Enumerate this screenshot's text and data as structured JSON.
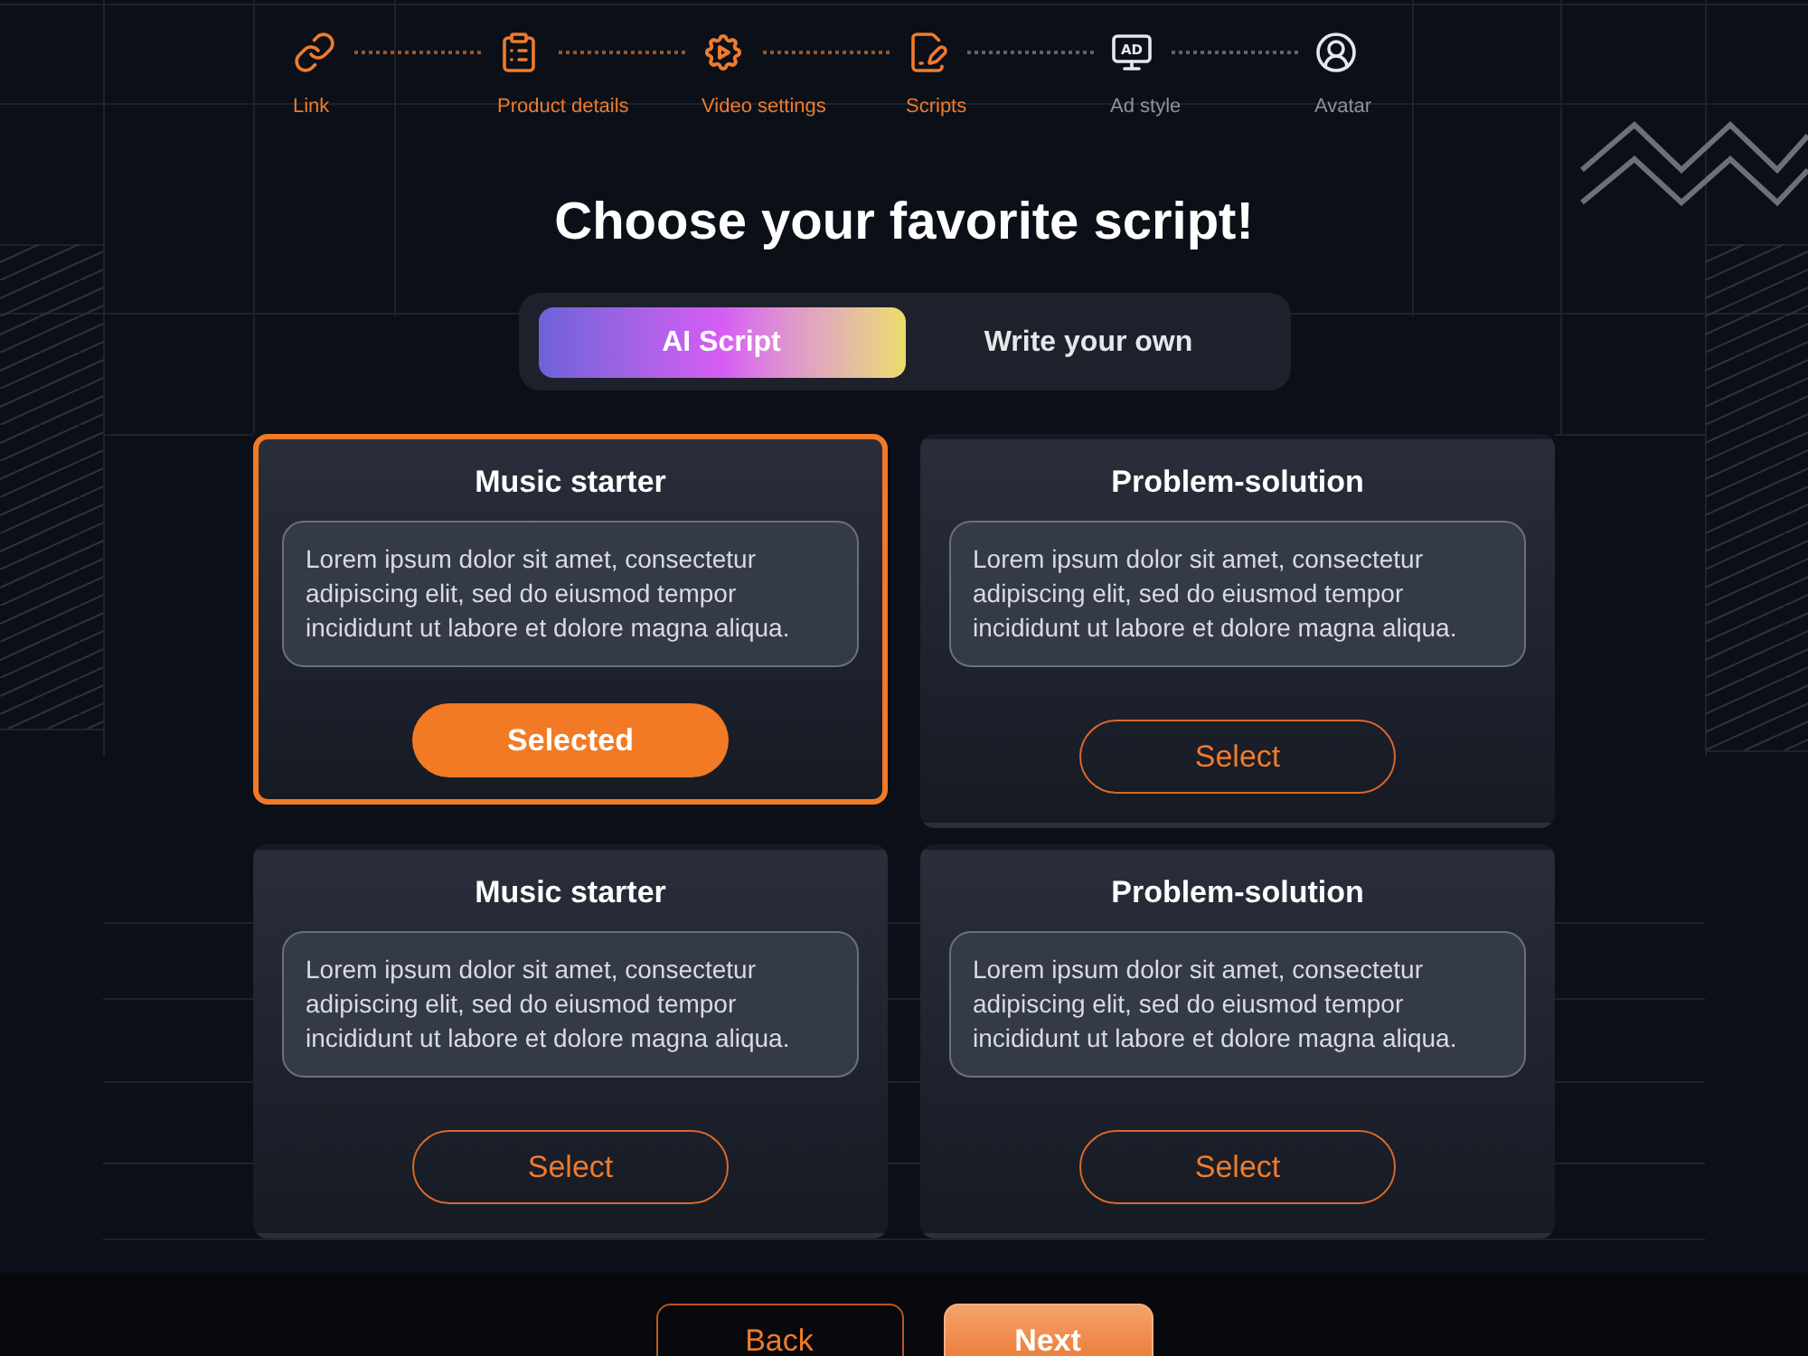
{
  "stepper": {
    "steps": [
      {
        "kind": "link",
        "label": "Link",
        "completed": true
      },
      {
        "kind": "clipboard",
        "label": "Product details",
        "completed": true
      },
      {
        "kind": "gear",
        "label": "Video settings",
        "completed": true
      },
      {
        "kind": "script",
        "label": "Scripts",
        "completed": true
      },
      {
        "kind": "monitor",
        "label": "Ad style",
        "completed": false,
        "icon_text": "AD"
      },
      {
        "kind": "user",
        "label": "Avatar",
        "completed": false
      }
    ]
  },
  "heading": "Choose your favorite script!",
  "mode_tabs": [
    {
      "label": "AI Script",
      "selected": true
    },
    {
      "label": "Write your own",
      "selected": false
    }
  ],
  "scripts": [
    {
      "title": "Music starter",
      "text": "Lorem ipsum dolor sit amet, consectetur adipiscing elit, sed do eiusmod tempor incididunt ut labore et dolore magna aliqua.",
      "button": "Selected",
      "selected": true
    },
    {
      "title": "Problem-solution",
      "text": "Lorem ipsum dolor sit amet, consectetur adipiscing elit, sed do eiusmod tempor incididunt ut labore et dolore magna aliqua.",
      "button": "Select",
      "selected": false
    },
    {
      "title": "Music starter",
      "text": "Lorem ipsum dolor sit amet, consectetur adipiscing elit, sed do eiusmod tempor incididunt ut labore et dolore magna aliqua.",
      "button": "Select",
      "selected": false
    },
    {
      "title": "Problem-solution",
      "text": "Lorem ipsum dolor sit amet, consectetur adipiscing elit, sed do eiusmod tempor incididunt ut labore et dolore magna aliqua.",
      "button": "Select",
      "selected": false
    }
  ],
  "footer": {
    "buttons": [
      {
        "kind": "secondary",
        "label": "Back"
      },
      {
        "kind": "primary",
        "label": "Next"
      }
    ]
  }
}
